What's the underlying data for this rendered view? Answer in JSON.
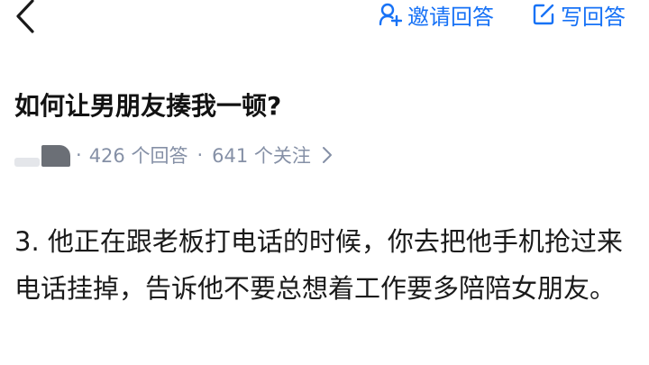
{
  "header": {
    "invite_label": "邀请回答",
    "write_label": "写回答"
  },
  "question": {
    "title": "如何让男朋友揍我一顿?",
    "answers_count": "426 个回答",
    "followers_count": "641 个关注"
  },
  "answer": {
    "text": "3. 他正在跟老板打电话的时候，你去把他手机抢过来电话挂掉，告诉他不要总想着工作要多陪陪女朋友。"
  },
  "colors": {
    "accent": "#1772f6",
    "meta_text": "#8590a6"
  }
}
